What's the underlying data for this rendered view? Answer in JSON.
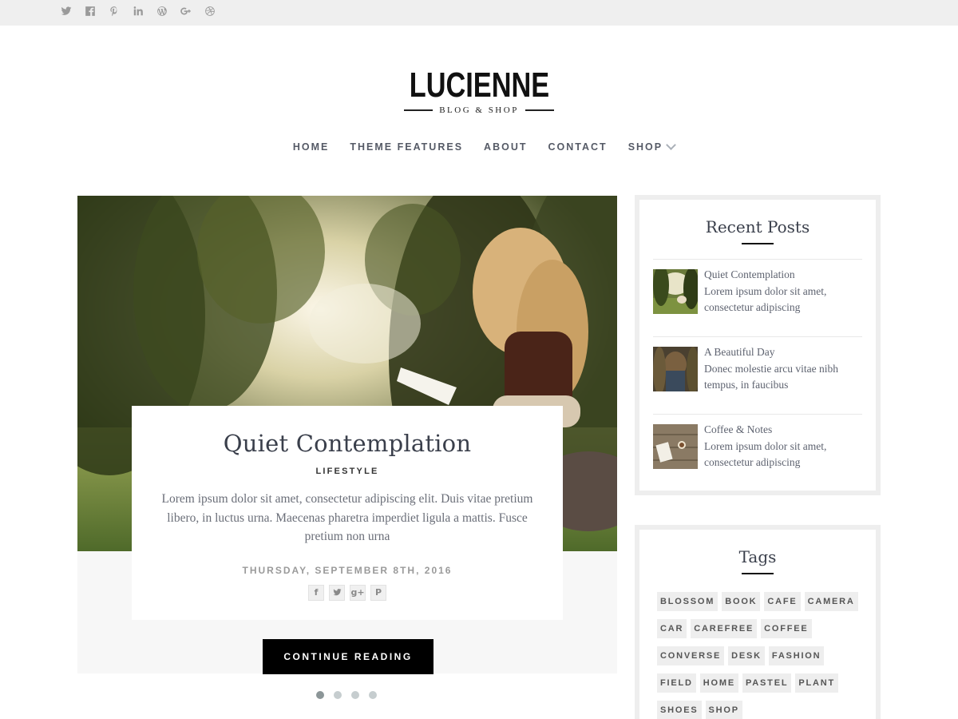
{
  "topbar": {
    "social": [
      {
        "icon": "twitter-icon",
        "glyph": ""
      },
      {
        "icon": "facebook-icon",
        "glyph": "f"
      },
      {
        "icon": "pinterest-icon",
        "glyph": "P"
      },
      {
        "icon": "linkedin-icon",
        "glyph": "in"
      },
      {
        "icon": "wordpress-icon",
        "glyph": "W"
      },
      {
        "icon": "google-plus-icon",
        "glyph": "g+"
      },
      {
        "icon": "dribbble-icon",
        "glyph": "◎"
      }
    ]
  },
  "logo": {
    "title": "LUCIENNE",
    "subtitle": "BLOG & SHOP"
  },
  "nav": {
    "items": [
      {
        "label": "HOME"
      },
      {
        "label": "THEME FEATURES"
      },
      {
        "label": "ABOUT"
      },
      {
        "label": "CONTACT"
      },
      {
        "label": "SHOP",
        "icon": "chevron-down-icon"
      }
    ]
  },
  "slider": {
    "title": "Quiet Contemplation",
    "category": "LIFESTYLE",
    "excerpt": "Lorem ipsum dolor sit amet, consectetur adipiscing elit. Duis vitae pretium libero, in luctus urna. Maecenas pharetra imperdiet ligula a mattis. Fusce pretium non urna",
    "date": "THURSDAY, SEPTEMBER 8TH, 2016",
    "share": [
      {
        "icon": "facebook-icon",
        "glyph": "f"
      },
      {
        "icon": "twitter-icon",
        "glyph": "t"
      },
      {
        "icon": "google-plus-icon",
        "glyph": "g+"
      },
      {
        "icon": "pinterest-icon",
        "glyph": "P"
      }
    ],
    "button": "CONTINUE READING",
    "dots": 4,
    "active_dot": 1
  },
  "recent_posts": {
    "title": "Recent Posts",
    "items": [
      {
        "title": "Quiet Contemplation",
        "excerpt": "Lorem ipsum dolor sit amet, consectetur adipiscing"
      },
      {
        "title": "A Beautiful Day",
        "excerpt": "Donec molestie arcu vitae nibh tempus, in faucibus"
      },
      {
        "title": "Coffee & Notes",
        "excerpt": "Lorem ipsum dolor sit amet, consectetur adipiscing"
      }
    ]
  },
  "tags": {
    "title": "Tags",
    "items": [
      "BLOSSOM",
      "BOOK",
      "CAFE",
      "CAMERA",
      "CAR",
      "CAREFREE",
      "COFFEE",
      "CONVERSE",
      "DESK",
      "FASHION",
      "FIELD",
      "HOME",
      "PASTEL",
      "PLANT",
      "SHOES",
      "SHOP"
    ]
  },
  "colors": {
    "topbar_bg": "#efefef",
    "text_dark": "#3a3f4b",
    "button_bg": "#000000",
    "widget_border": "#eeeeee"
  }
}
